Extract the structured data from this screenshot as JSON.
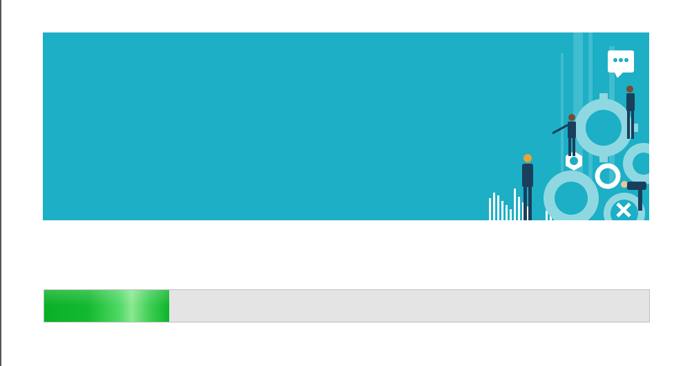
{
  "banner": {
    "background_color": "#1cafc5",
    "illustration": "business-teamwork-gears-illustration",
    "icons": [
      "speech-bubble-icon",
      "gear-icon",
      "hexagon-nut-icon",
      "ring-icon",
      "bar-chart-icon"
    ]
  },
  "progress": {
    "fraction": 0.207,
    "fill_color": "#0cb22a",
    "track_color": "#e4e4e4"
  }
}
